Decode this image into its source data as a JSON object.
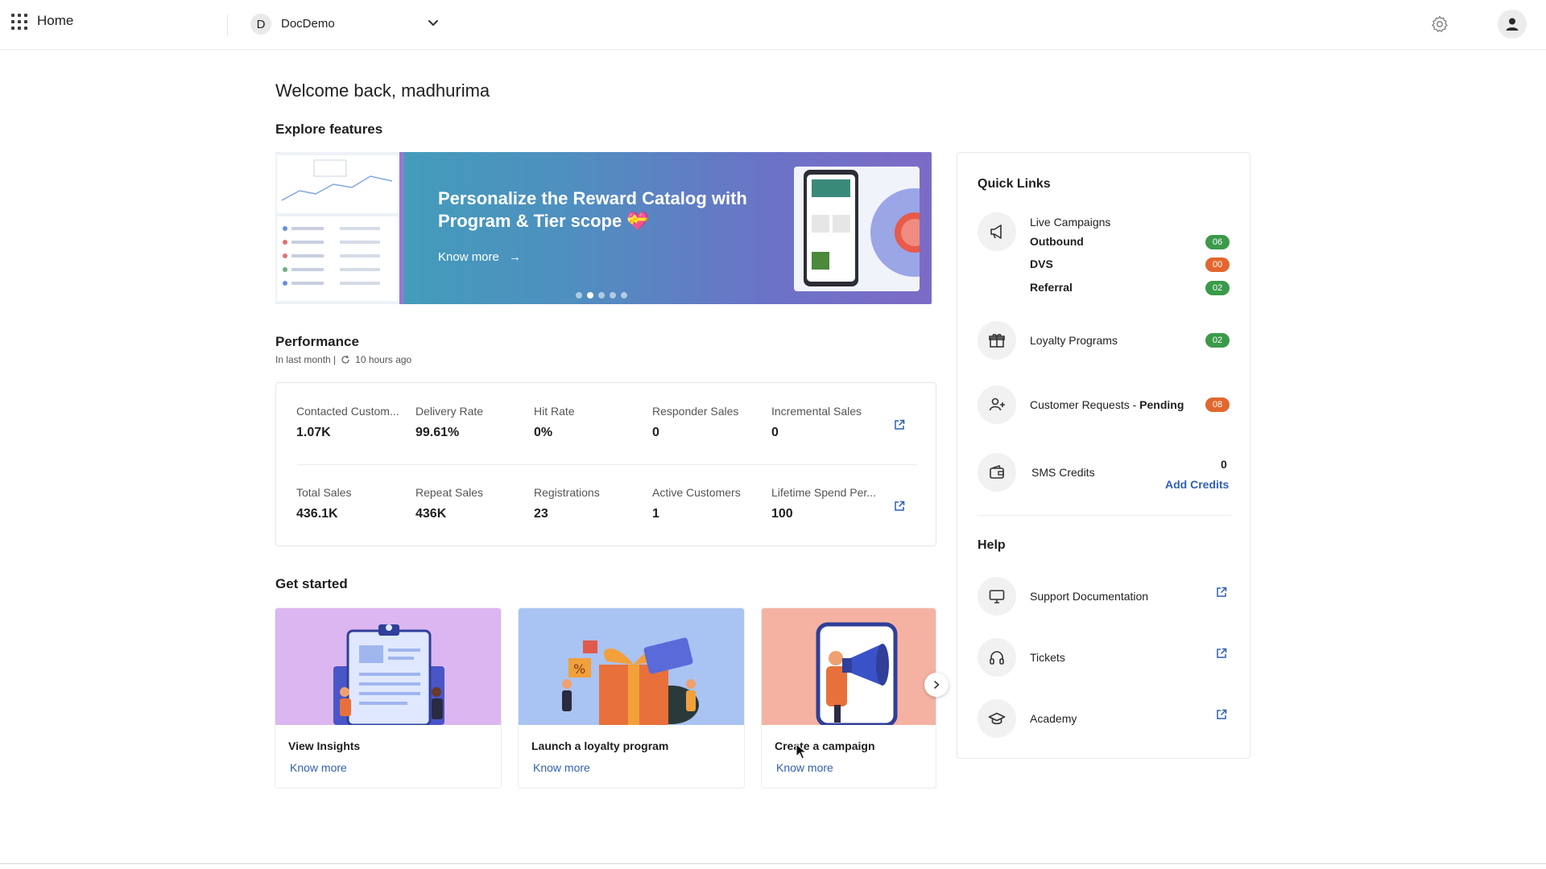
{
  "header": {
    "title": "Home",
    "org_initial": "D",
    "org_name": "DocDemo"
  },
  "welcome": "Welcome back, madhurima",
  "explore": {
    "heading": "Explore features",
    "banner_title": "Personalize the Reward Catalog with Program & Tier scope 💝",
    "banner_link": "Know more",
    "active_slide": 2,
    "slide_count": 5
  },
  "performance": {
    "heading": "Performance",
    "period": "In last month |",
    "updated": "10 hours ago",
    "row1": [
      {
        "label": "Contacted Custom...",
        "value": "1.07K"
      },
      {
        "label": "Delivery Rate",
        "value": "99.61%"
      },
      {
        "label": "Hit Rate",
        "value": "0%"
      },
      {
        "label": "Responder Sales",
        "value": "0"
      },
      {
        "label": "Incremental Sales",
        "value": "0"
      }
    ],
    "row2": [
      {
        "label": "Total Sales",
        "value": "436.1K"
      },
      {
        "label": "Repeat Sales",
        "value": "436K"
      },
      {
        "label": "Registrations",
        "value": "23"
      },
      {
        "label": "Active Customers",
        "value": "1"
      },
      {
        "label": "Lifetime Spend Per...",
        "value": "100"
      }
    ]
  },
  "get_started": {
    "heading": "Get started",
    "cards": [
      {
        "title": "View Insights",
        "link": "Know more"
      },
      {
        "title": "Launch a loyalty program",
        "link": "Know more"
      },
      {
        "title": "Create a campaign",
        "link": "Know more"
      }
    ]
  },
  "quick_links": {
    "heading": "Quick Links",
    "live_campaigns": {
      "label": "Live Campaigns",
      "items": [
        {
          "label": "Outbound",
          "count": "06",
          "status": "green"
        },
        {
          "label": "DVS",
          "count": "00",
          "status": "orange"
        },
        {
          "label": "Referral",
          "count": "02",
          "status": "green"
        }
      ]
    },
    "loyalty": {
      "label": "Loyalty Programs",
      "count": "02"
    },
    "customer_requests": {
      "label": "Customer Requests - ",
      "label_bold": "Pending",
      "count": "08"
    },
    "sms": {
      "label": "SMS Credits",
      "value": "0",
      "action": "Add Credits"
    }
  },
  "help": {
    "heading": "Help",
    "items": [
      {
        "label": "Support Documentation",
        "icon": "monitor-icon"
      },
      {
        "label": "Tickets",
        "icon": "headset-icon"
      },
      {
        "label": "Academy",
        "icon": "graduation-cap-icon"
      }
    ]
  },
  "colors": {
    "link": "#2f5fb3",
    "badge_green": "#3a9a4a",
    "badge_orange": "#e2672e"
  }
}
